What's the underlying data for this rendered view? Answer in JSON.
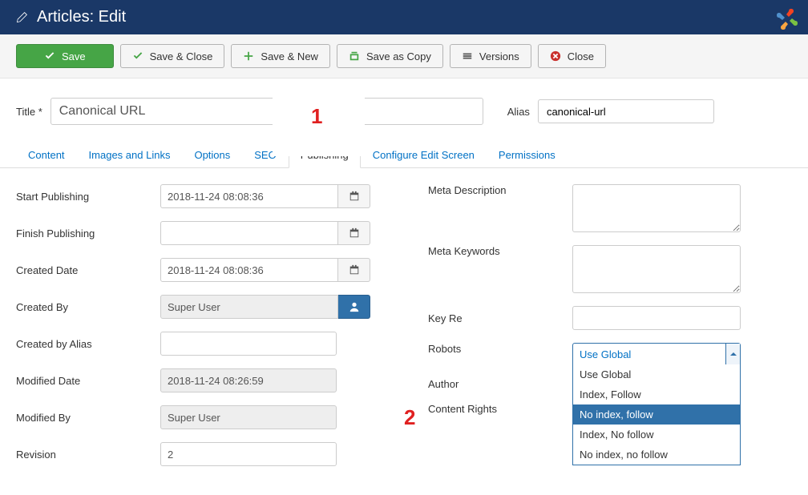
{
  "header": {
    "title": "Articles: Edit"
  },
  "toolbar": {
    "save": "Save",
    "save_close": "Save & Close",
    "save_new": "Save & New",
    "save_copy": "Save as Copy",
    "versions": "Versions",
    "close": "Close"
  },
  "title_field": {
    "label": "Title *",
    "value": "Canonical URL"
  },
  "alias_field": {
    "label": "Alias",
    "value": "canonical-url"
  },
  "annotations": {
    "one": "1",
    "two": "2"
  },
  "tabs": {
    "content": "Content",
    "images": "Images and Links",
    "options": "Options",
    "seo": "SEO",
    "publishing": "Publishing",
    "configure": "Configure Edit Screen",
    "permissions": "Permissions"
  },
  "left": {
    "start_publishing": {
      "label": "Start Publishing",
      "value": "2018-11-24 08:08:36"
    },
    "finish_publishing": {
      "label": "Finish Publishing",
      "value": ""
    },
    "created_date": {
      "label": "Created Date",
      "value": "2018-11-24 08:08:36"
    },
    "created_by": {
      "label": "Created By",
      "value": "Super User"
    },
    "created_by_alias": {
      "label": "Created by Alias",
      "value": ""
    },
    "modified_date": {
      "label": "Modified Date",
      "value": "2018-11-24 08:26:59"
    },
    "modified_by": {
      "label": "Modified By",
      "value": "Super User"
    },
    "revision": {
      "label": "Revision",
      "value": "2"
    }
  },
  "right": {
    "meta_description": {
      "label": "Meta Description",
      "value": ""
    },
    "meta_keywords": {
      "label": "Meta Keywords",
      "value": ""
    },
    "key_reference": {
      "label": "Key Re",
      "value": ""
    },
    "robots": {
      "label": "Robots",
      "selected": "Use Global",
      "options": [
        "Use Global",
        "Index, Follow",
        "No index, follow",
        "Index, No follow",
        "No index, no follow"
      ],
      "highlighted_index": 2
    },
    "author": {
      "label": "Author"
    },
    "content_rights": {
      "label": "Content Rights"
    }
  }
}
